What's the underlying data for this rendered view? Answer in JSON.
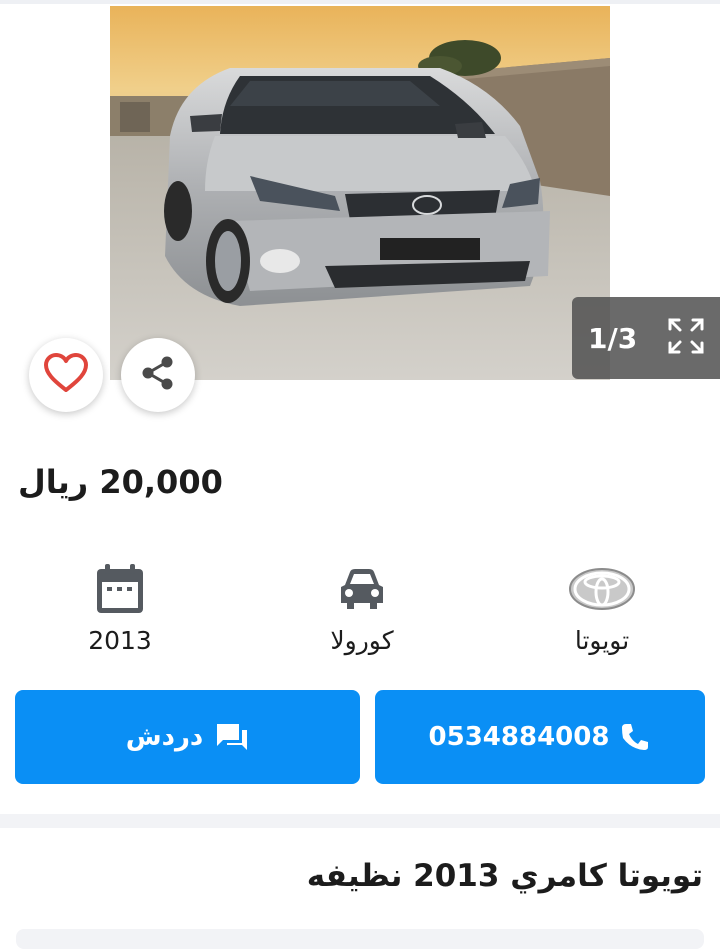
{
  "gallery": {
    "counter": "1/3",
    "icons": {
      "prev": "chevron-left-icon",
      "next": "chevron-right-icon",
      "expand": "fullscreen-icon",
      "favorite": "heart-icon",
      "share": "share-icon"
    }
  },
  "listing": {
    "price": "20,000 ريال",
    "title": "تويوتا كامري 2013 نظيفه"
  },
  "specs": {
    "year": {
      "value": "2013",
      "icon": "calendar-icon"
    },
    "model": {
      "value": "كورولا",
      "icon": "car-icon"
    },
    "make": {
      "value": "تويوتا",
      "icon": "toyota-logo-icon"
    }
  },
  "actions": {
    "chat_label": "دردش",
    "phone": "0534884008"
  },
  "colors": {
    "primary_button": "#0a8ff5",
    "heart": "#e0453c",
    "counter_bg": "#505050"
  }
}
